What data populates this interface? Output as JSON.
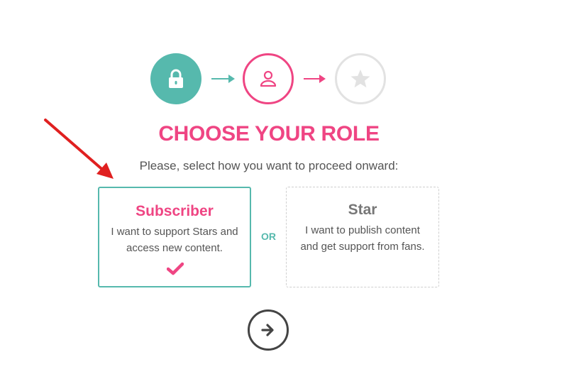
{
  "steps": [
    {
      "icon": "lock-icon",
      "state": "complete",
      "color": "#56b9ad"
    },
    {
      "icon": "user-icon",
      "state": "current",
      "color": "#ef4583"
    },
    {
      "icon": "star-icon",
      "state": "pending",
      "color": "#e2e2e2"
    }
  ],
  "heading": {
    "title": "CHOOSE YOUR ROLE",
    "subtitle": "Please, select how you want to proceed onward:"
  },
  "roles": {
    "subscriber": {
      "title": "Subscriber",
      "description": "I want to support Stars and access new content.",
      "selected": true
    },
    "star": {
      "title": "Star",
      "description": "I want to publish content and get support from fans.",
      "selected": false
    }
  },
  "or_label": "OR",
  "next_button": {
    "icon": "arrow-right-icon"
  },
  "colors": {
    "accent_pink": "#ef4583",
    "accent_teal": "#56b9ad",
    "inactive_gray": "#e2e2e2",
    "annotation_red": "#e02020"
  }
}
